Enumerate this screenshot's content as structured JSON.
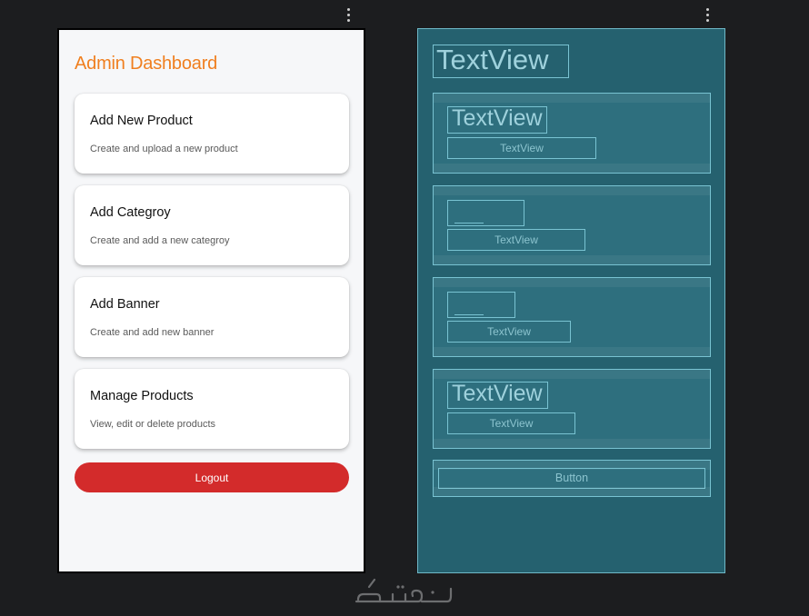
{
  "dashboard": {
    "title": "Admin Dashboard",
    "accent_color": "#f07f1f",
    "cards": [
      {
        "title": "Add New Product",
        "subtitle": "Create and upload a new product"
      },
      {
        "title": "Add Categroy",
        "subtitle": "Create and add a new categroy"
      },
      {
        "title": "Add Banner",
        "subtitle": "Create and add new banner"
      },
      {
        "title": "Manage Products",
        "subtitle": "View, edit or delete products"
      }
    ],
    "logout_label": "Logout",
    "logout_color": "#d32b2b"
  },
  "blueprint": {
    "title": "TextView",
    "cards": [
      {
        "title": "TextView",
        "subtitle": "TextView"
      },
      {
        "title": "",
        "subtitle": "TextView"
      },
      {
        "title": "",
        "subtitle": "TextView"
      },
      {
        "title": "TextView",
        "subtitle": "TextView"
      }
    ],
    "button_label": "Button",
    "background_color": "#25616f"
  },
  "icons": {
    "overflow_menu": "more-vert-icon"
  }
}
